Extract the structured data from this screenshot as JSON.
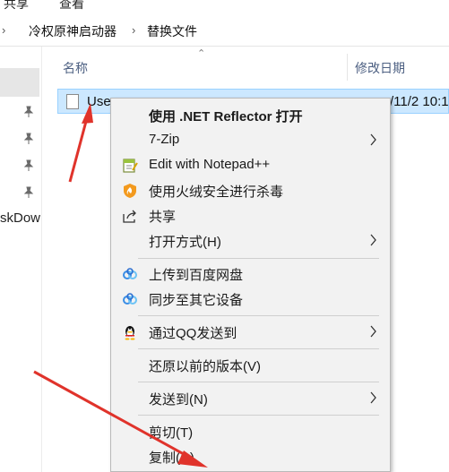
{
  "ribbon": {
    "tab_share": "共享",
    "tab_view": "查看"
  },
  "address": {
    "crumbs": [
      "冷权原神启动器",
      "替换文件"
    ]
  },
  "nav": {
    "partial_label": "skDow"
  },
  "columns": {
    "name": "名称",
    "modified": "修改日期"
  },
  "file": {
    "name": "Use",
    "date": "/11/2 10:1"
  },
  "menu": {
    "items": [
      {
        "label": "使用 .NET Reflector 打开",
        "bold": true
      },
      {
        "label": "7-Zip",
        "submenu": true
      },
      {
        "label": "Edit with Notepad++",
        "icon": "notepad-plus-icon"
      },
      {
        "label": "使用火绒安全进行杀毒",
        "icon": "huorong-shield-icon"
      },
      {
        "label": "共享",
        "icon": "share-icon"
      },
      {
        "label": "打开方式(H)",
        "submenu": true
      },
      {
        "label": "上传到百度网盘",
        "icon": "baidu-netdisk-icon"
      },
      {
        "label": "同步至其它设备",
        "icon": "baidu-netdisk-icon"
      },
      {
        "label": "通过QQ发送到",
        "icon": "qq-penguin-icon",
        "submenu": true
      },
      {
        "label": "还原以前的版本(V)"
      },
      {
        "label": "发送到(N)",
        "submenu": true
      },
      {
        "label": "剪切(T)"
      },
      {
        "label": "复制(C)"
      }
    ]
  },
  "colors": {
    "accent_red": "#e0332b",
    "selection": "#cce8ff",
    "menu_bg": "#f2f2f2"
  }
}
